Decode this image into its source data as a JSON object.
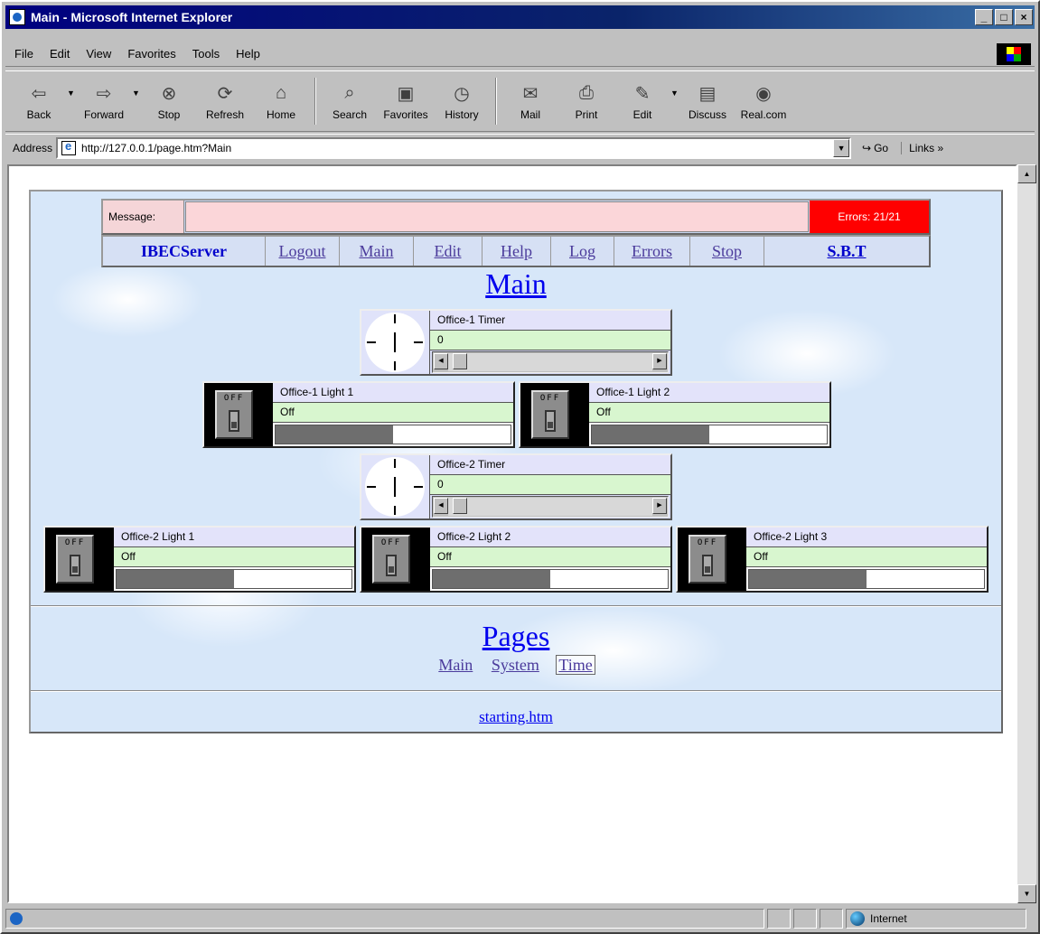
{
  "window": {
    "title": "Main - Microsoft Internet Explorer"
  },
  "menu": [
    "File",
    "Edit",
    "View",
    "Favorites",
    "Tools",
    "Help"
  ],
  "toolbar": [
    {
      "label": "Back",
      "icon": "back-arrow-icon",
      "glyph": "⇦"
    },
    {
      "label": "Forward",
      "icon": "forward-arrow-icon",
      "glyph": "⇨"
    },
    {
      "label": "Stop",
      "icon": "stop-icon",
      "glyph": "⊗"
    },
    {
      "label": "Refresh",
      "icon": "refresh-icon",
      "glyph": "⟳"
    },
    {
      "label": "Home",
      "icon": "home-icon",
      "glyph": "⌂"
    },
    {
      "label": "Search",
      "icon": "search-icon",
      "glyph": "⌕"
    },
    {
      "label": "Favorites",
      "icon": "favorites-icon",
      "glyph": "▣"
    },
    {
      "label": "History",
      "icon": "history-icon",
      "glyph": "◷"
    },
    {
      "label": "Mail",
      "icon": "mail-icon",
      "glyph": "✉"
    },
    {
      "label": "Print",
      "icon": "print-icon",
      "glyph": "⎙"
    },
    {
      "label": "Edit",
      "icon": "edit-icon",
      "glyph": "✎"
    },
    {
      "label": "Discuss",
      "icon": "discuss-icon",
      "glyph": "▤"
    },
    {
      "label": "Real.com",
      "icon": "realcom-icon",
      "glyph": "◉"
    }
  ],
  "address": {
    "label": "Address",
    "url": "http://127.0.0.1/page.htm?Main",
    "go": "Go",
    "links": "Links »"
  },
  "page": {
    "message_label": "Message:",
    "message_value": "",
    "errors": "Errors: 21/21",
    "nav": {
      "brand": "IBECServer",
      "links": [
        "Logout",
        "Main",
        "Edit",
        "Help",
        "Log",
        "Errors",
        "Stop"
      ],
      "sbt": "S.B.T"
    },
    "heading": "Main",
    "timers": [
      {
        "name": "Office-1 Timer",
        "value": "0"
      },
      {
        "name": "Office-2 Timer",
        "value": "0"
      }
    ],
    "switch_label": "OFF",
    "lights": [
      {
        "name": "Office-1 Light 1",
        "value": "Off",
        "level": 0.5
      },
      {
        "name": "Office-1 Light 2",
        "value": "Off",
        "level": 0.5
      },
      {
        "name": "Office-2 Light 1",
        "value": "Off",
        "level": 0.5
      },
      {
        "name": "Office-2 Light 2",
        "value": "Off",
        "level": 0.5
      },
      {
        "name": "Office-2 Light 3",
        "value": "Off",
        "level": 0.5
      }
    ],
    "pages_heading": "Pages",
    "page_links": [
      "Main",
      "System",
      "Time"
    ],
    "footer_link": "starting.htm"
  },
  "status": {
    "zone": "Internet"
  },
  "colors": {
    "error_bg": "#ff0000",
    "message_bg": "#fbd6d9",
    "value_bg": "#d8f6cf",
    "name_bg": "#e3e3fa"
  }
}
